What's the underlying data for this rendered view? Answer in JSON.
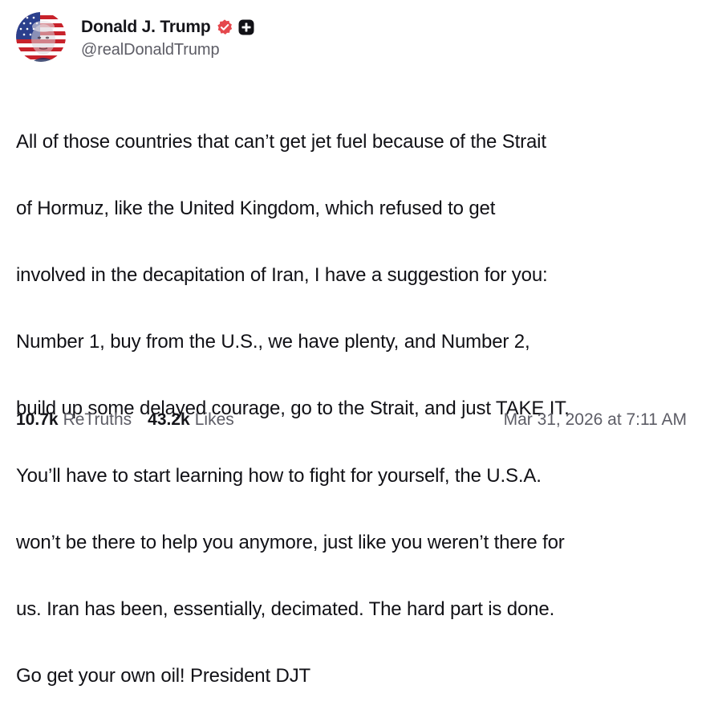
{
  "post": {
    "author": {
      "display_name": "Donald J. Trump",
      "handle": "@realDonaldTrump",
      "verified_badge_color": "#e5484d",
      "plus_badge_color": "#111116"
    },
    "body_lines": [
      "All of those countries that can’t get jet fuel because of the Strait",
      "of Hormuz, like the United Kingdom, which refused to get",
      "involved in the decapitation of Iran, I have a suggestion for you:",
      "Number 1, buy from the U.S., we have plenty, and Number 2,",
      "build up some delayed courage, go to the Strait, and just TAKE IT.",
      "You’ll have to start learning how to fight for yourself, the U.S.A.",
      "won’t be there to help you anymore, just like you weren’t there for",
      "us. Iran has been, essentially, decimated. The hard part is done.",
      "Go get your own oil! President DJT"
    ],
    "stats": {
      "retruths_count": "10.7k",
      "retruths_label": "ReTruths",
      "likes_count": "43.2k",
      "likes_label": "Likes"
    },
    "timestamp": "Mar 31, 2026 at 7:11 AM"
  }
}
